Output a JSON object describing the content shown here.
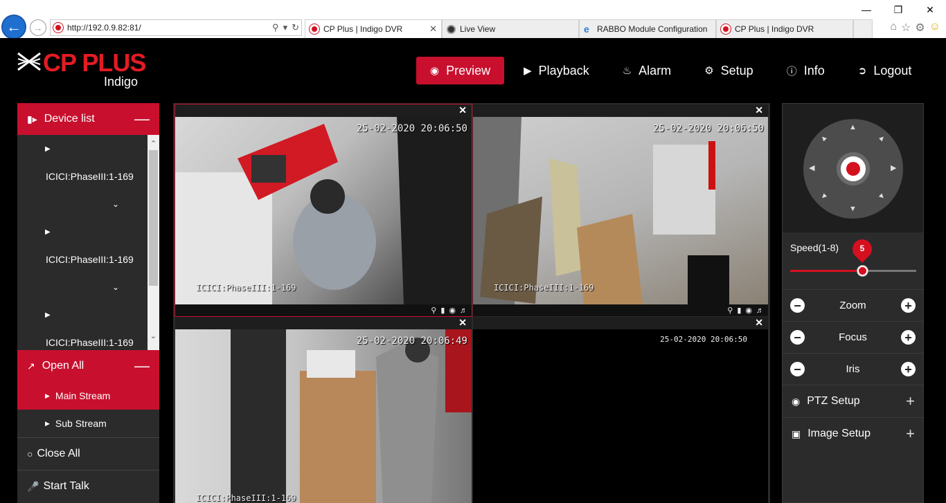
{
  "browser": {
    "url": "http://192.0.9.82:81/",
    "tabs": [
      {
        "title": "CP Plus | Indigo DVR",
        "active": true
      },
      {
        "title": "Live View",
        "active": false
      },
      {
        "title": "RABBO Module Configuration",
        "active": false
      },
      {
        "title": "CP Plus | Indigo DVR",
        "active": false
      }
    ]
  },
  "brand": {
    "name": "CP PLUS",
    "sub": "Indigo",
    "color": "#e31b23"
  },
  "nav": {
    "preview": "Preview",
    "playback": "Playback",
    "alarm": "Alarm",
    "setup": "Setup",
    "info": "Info",
    "logout": "Logout"
  },
  "left": {
    "device_list_title": "Device list",
    "devices": [
      "ICICI:PhaseIII:1-169",
      "ICICI:PhaseIII:1-169",
      "ICICI:PhaseIII:1-169"
    ],
    "open_all": "Open All",
    "main_stream": "Main Stream",
    "sub_stream": "Sub Stream",
    "close_all": "Close All",
    "start_talk": "Start Talk"
  },
  "videos": [
    {
      "timestamp": "25-02-2020 20:06:50",
      "name": "ICICI:PhaseIII:1-169",
      "selected": true
    },
    {
      "timestamp": "25-02-2020 20:06:50",
      "name": "ICICI:PhaseIII:1-169",
      "selected": false
    },
    {
      "timestamp": "25-02-2020 20:06:49",
      "name": "ICICI:PhaseIII:1-169",
      "selected": false
    },
    {
      "timestamp": "25-02-2020 20:06:50",
      "name": "",
      "selected": false
    }
  ],
  "ptz": {
    "speed_label": "Speed(1-8)",
    "speed_value": "5",
    "speed_min": 1,
    "speed_max": 8,
    "zoom": "Zoom",
    "focus": "Focus",
    "iris": "Iris",
    "ptz_setup": "PTZ Setup",
    "image_setup": "Image Setup"
  },
  "colors": {
    "accent": "#c8102e",
    "panel": "#2b2b2b"
  }
}
